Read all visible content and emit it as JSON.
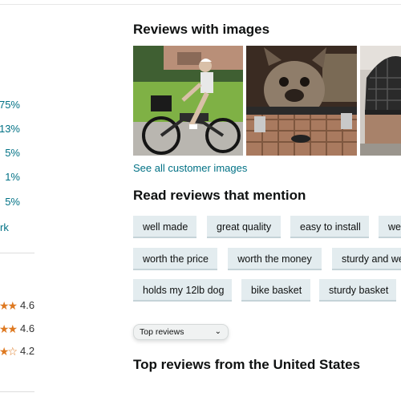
{
  "left_panel": {
    "percentages": [
      "75%",
      "13%",
      "5%",
      "1%",
      "5%"
    ],
    "link_fragment": "rk",
    "feature_ratings": [
      {
        "stars": "★★★",
        "value": "4.6"
      },
      {
        "stars": "★★★",
        "value": "4.6"
      },
      {
        "stars": "★★☆",
        "value": "4.2"
      }
    ]
  },
  "reviews_with_images": {
    "heading": "Reviews with images",
    "see_all": "See all customer images"
  },
  "read_reviews": {
    "heading": "Read reviews that mention",
    "chips": [
      "well made",
      "great quality",
      "easy to install",
      "we",
      "worth the price",
      "worth the money",
      "sturdy and we",
      "holds my 12lb dog",
      "bike basket",
      "sturdy basket"
    ]
  },
  "sort": {
    "selected": "Top reviews"
  },
  "top_reviews": {
    "heading": "Top reviews from the United States"
  },
  "colors": {
    "link": "#007185",
    "star": "#de7921",
    "chip_bg": "#e3ecef"
  }
}
